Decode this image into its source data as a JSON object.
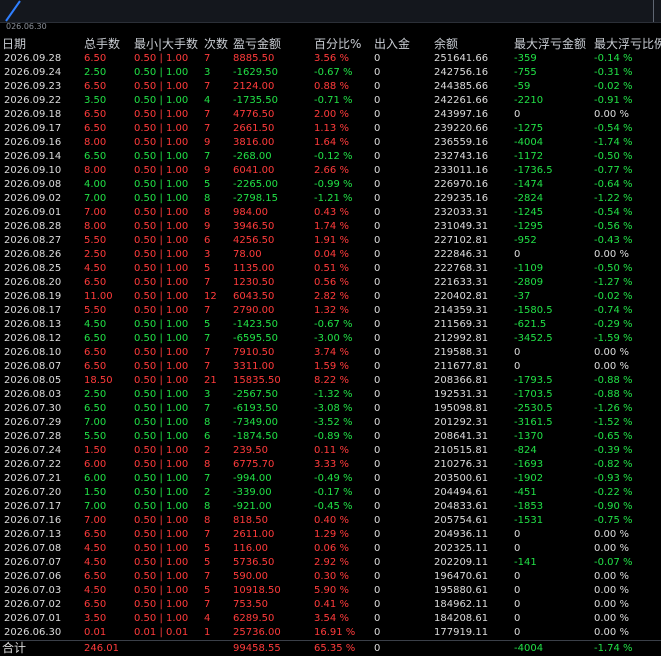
{
  "chart": {
    "date_label": "026.06.30"
  },
  "table": {
    "columns": [
      "日期",
      "总手数",
      "最小|大手数",
      "次数",
      "盈亏金额",
      "百分比%",
      "出入金",
      "余额",
      "最大浮亏金额",
      "最大浮亏比例"
    ],
    "rows": [
      {
        "date": "2026.09.28",
        "lots": "6.50",
        "minmax": "0.50 | 1.00",
        "count": "7",
        "pnl": "8885.50",
        "pct": "3.56 %",
        "io": "0",
        "balance": "251641.66",
        "maxdd": "-359",
        "maxddpct": "-0.14 %",
        "tone": "win"
      },
      {
        "date": "2026.09.24",
        "lots": "2.50",
        "minmax": "0.50 | 1.00",
        "count": "3",
        "pnl": "-1629.50",
        "pct": "-0.67 %",
        "io": "0",
        "balance": "242756.16",
        "maxdd": "-755",
        "maxddpct": "-0.31 %",
        "tone": "loss"
      },
      {
        "date": "2026.09.23",
        "lots": "6.50",
        "minmax": "0.50 | 1.00",
        "count": "7",
        "pnl": "2124.00",
        "pct": "0.88 %",
        "io": "0",
        "balance": "244385.66",
        "maxdd": "-59",
        "maxddpct": "-0.02 %",
        "tone": "win"
      },
      {
        "date": "2026.09.22",
        "lots": "3.50",
        "minmax": "0.50 | 1.00",
        "count": "4",
        "pnl": "-1735.50",
        "pct": "-0.71 %",
        "io": "0",
        "balance": "242261.66",
        "maxdd": "-2210",
        "maxddpct": "-0.91 %",
        "tone": "loss"
      },
      {
        "date": "2026.09.18",
        "lots": "6.50",
        "minmax": "0.50 | 1.00",
        "count": "7",
        "pnl": "4776.50",
        "pct": "2.00 %",
        "io": "0",
        "balance": "243997.16",
        "maxdd": "0",
        "maxddpct": "0.00 %",
        "tone": "win"
      },
      {
        "date": "2026.09.17",
        "lots": "6.50",
        "minmax": "0.50 | 1.00",
        "count": "7",
        "pnl": "2661.50",
        "pct": "1.13 %",
        "io": "0",
        "balance": "239220.66",
        "maxdd": "-1275",
        "maxddpct": "-0.54 %",
        "tone": "win"
      },
      {
        "date": "2026.09.16",
        "lots": "8.00",
        "minmax": "0.50 | 1.00",
        "count": "9",
        "pnl": "3816.00",
        "pct": "1.64 %",
        "io": "0",
        "balance": "236559.16",
        "maxdd": "-4004",
        "maxddpct": "-1.74 %",
        "tone": "win"
      },
      {
        "date": "2026.09.14",
        "lots": "6.50",
        "minmax": "0.50 | 1.00",
        "count": "7",
        "pnl": "-268.00",
        "pct": "-0.12 %",
        "io": "0",
        "balance": "232743.16",
        "maxdd": "-1172",
        "maxddpct": "-0.50 %",
        "tone": "loss"
      },
      {
        "date": "2026.09.10",
        "lots": "8.00",
        "minmax": "0.50 | 1.00",
        "count": "9",
        "pnl": "6041.00",
        "pct": "2.66 %",
        "io": "0",
        "balance": "233011.16",
        "maxdd": "-1736.5",
        "maxddpct": "-0.77 %",
        "tone": "win"
      },
      {
        "date": "2026.09.08",
        "lots": "4.00",
        "minmax": "0.50 | 1.00",
        "count": "5",
        "pnl": "-2265.00",
        "pct": "-0.99 %",
        "io": "0",
        "balance": "226970.16",
        "maxdd": "-1474",
        "maxddpct": "-0.64 %",
        "tone": "loss"
      },
      {
        "date": "2026.09.02",
        "lots": "7.00",
        "minmax": "0.50 | 1.00",
        "count": "8",
        "pnl": "-2798.15",
        "pct": "-1.21 %",
        "io": "0",
        "balance": "229235.16",
        "maxdd": "-2824",
        "maxddpct": "-1.22 %",
        "tone": "loss"
      },
      {
        "date": "2026.09.01",
        "lots": "7.00",
        "minmax": "0.50 | 1.00",
        "count": "8",
        "pnl": "984.00",
        "pct": "0.43 %",
        "io": "0",
        "balance": "232033.31",
        "maxdd": "-1245",
        "maxddpct": "-0.54 %",
        "tone": "win"
      },
      {
        "date": "2026.08.28",
        "lots": "8.00",
        "minmax": "0.50 | 1.00",
        "count": "9",
        "pnl": "3946.50",
        "pct": "1.74 %",
        "io": "0",
        "balance": "231049.31",
        "maxdd": "-1295",
        "maxddpct": "-0.56 %",
        "tone": "win"
      },
      {
        "date": "2026.08.27",
        "lots": "5.50",
        "minmax": "0.50 | 1.00",
        "count": "6",
        "pnl": "4256.50",
        "pct": "1.91 %",
        "io": "0",
        "balance": "227102.81",
        "maxdd": "-952",
        "maxddpct": "-0.43 %",
        "tone": "win"
      },
      {
        "date": "2026.08.26",
        "lots": "2.50",
        "minmax": "0.50 | 1.00",
        "count": "3",
        "pnl": "78.00",
        "pct": "0.04 %",
        "io": "0",
        "balance": "222846.31",
        "maxdd": "0",
        "maxddpct": "0.00 %",
        "tone": "win"
      },
      {
        "date": "2026.08.25",
        "lots": "4.50",
        "minmax": "0.50 | 1.00",
        "count": "5",
        "pnl": "1135.00",
        "pct": "0.51 %",
        "io": "0",
        "balance": "222768.31",
        "maxdd": "-1109",
        "maxddpct": "-0.50 %",
        "tone": "win"
      },
      {
        "date": "2026.08.20",
        "lots": "6.50",
        "minmax": "0.50 | 1.00",
        "count": "7",
        "pnl": "1230.50",
        "pct": "0.56 %",
        "io": "0",
        "balance": "221633.31",
        "maxdd": "-2809",
        "maxddpct": "-1.27 %",
        "tone": "win"
      },
      {
        "date": "2026.08.19",
        "lots": "11.00",
        "minmax": "0.50 | 1.00",
        "count": "12",
        "pnl": "6043.50",
        "pct": "2.82 %",
        "io": "0",
        "balance": "220402.81",
        "maxdd": "-37",
        "maxddpct": "-0.02 %",
        "tone": "win"
      },
      {
        "date": "2026.08.17",
        "lots": "5.50",
        "minmax": "0.50 | 1.00",
        "count": "7",
        "pnl": "2790.00",
        "pct": "1.32 %",
        "io": "0",
        "balance": "214359.31",
        "maxdd": "-1580.5",
        "maxddpct": "-0.74 %",
        "tone": "win"
      },
      {
        "date": "2026.08.13",
        "lots": "4.50",
        "minmax": "0.50 | 1.00",
        "count": "5",
        "pnl": "-1423.50",
        "pct": "-0.67 %",
        "io": "0",
        "balance": "211569.31",
        "maxdd": "-621.5",
        "maxddpct": "-0.29 %",
        "tone": "loss"
      },
      {
        "date": "2026.08.12",
        "lots": "6.50",
        "minmax": "0.50 | 1.00",
        "count": "7",
        "pnl": "-6595.50",
        "pct": "-3.00 %",
        "io": "0",
        "balance": "212992.81",
        "maxdd": "-3452.5",
        "maxddpct": "-1.59 %",
        "tone": "loss"
      },
      {
        "date": "2026.08.10",
        "lots": "6.50",
        "minmax": "0.50 | 1.00",
        "count": "7",
        "pnl": "7910.50",
        "pct": "3.74 %",
        "io": "0",
        "balance": "219588.31",
        "maxdd": "0",
        "maxddpct": "0.00 %",
        "tone": "win"
      },
      {
        "date": "2026.08.07",
        "lots": "6.50",
        "minmax": "0.50 | 1.00",
        "count": "7",
        "pnl": "3311.00",
        "pct": "1.59 %",
        "io": "0",
        "balance": "211677.81",
        "maxdd": "0",
        "maxddpct": "0.00 %",
        "tone": "win"
      },
      {
        "date": "2026.08.05",
        "lots": "18.50",
        "minmax": "0.50 | 1.00",
        "count": "21",
        "pnl": "15835.50",
        "pct": "8.22 %",
        "io": "0",
        "balance": "208366.81",
        "maxdd": "-1793.5",
        "maxddpct": "-0.88 %",
        "tone": "win"
      },
      {
        "date": "2026.08.03",
        "lots": "2.50",
        "minmax": "0.50 | 1.00",
        "count": "3",
        "pnl": "-2567.50",
        "pct": "-1.32 %",
        "io": "0",
        "balance": "192531.31",
        "maxdd": "-1703.5",
        "maxddpct": "-0.88 %",
        "tone": "loss"
      },
      {
        "date": "2026.07.30",
        "lots": "6.50",
        "minmax": "0.50 | 1.00",
        "count": "7",
        "pnl": "-6193.50",
        "pct": "-3.08 %",
        "io": "0",
        "balance": "195098.81",
        "maxdd": "-2530.5",
        "maxddpct": "-1.26 %",
        "tone": "loss"
      },
      {
        "date": "2026.07.29",
        "lots": "7.00",
        "minmax": "0.50 | 1.00",
        "count": "8",
        "pnl": "-7349.00",
        "pct": "-3.52 %",
        "io": "0",
        "balance": "201292.31",
        "maxdd": "-3161.5",
        "maxddpct": "-1.52 %",
        "tone": "loss"
      },
      {
        "date": "2026.07.28",
        "lots": "5.50",
        "minmax": "0.50 | 1.00",
        "count": "6",
        "pnl": "-1874.50",
        "pct": "-0.89 %",
        "io": "0",
        "balance": "208641.31",
        "maxdd": "-1370",
        "maxddpct": "-0.65 %",
        "tone": "loss"
      },
      {
        "date": "2026.07.24",
        "lots": "1.50",
        "minmax": "0.50 | 1.00",
        "count": "2",
        "pnl": "239.50",
        "pct": "0.11 %",
        "io": "0",
        "balance": "210515.81",
        "maxdd": "-824",
        "maxddpct": "-0.39 %",
        "tone": "win"
      },
      {
        "date": "2026.07.22",
        "lots": "6.00",
        "minmax": "0.50 | 1.00",
        "count": "8",
        "pnl": "6775.70",
        "pct": "3.33 %",
        "io": "0",
        "balance": "210276.31",
        "maxdd": "-1693",
        "maxddpct": "-0.82 %",
        "tone": "win"
      },
      {
        "date": "2026.07.21",
        "lots": "6.00",
        "minmax": "0.50 | 1.00",
        "count": "7",
        "pnl": "-994.00",
        "pct": "-0.49 %",
        "io": "0",
        "balance": "203500.61",
        "maxdd": "-1902",
        "maxddpct": "-0.93 %",
        "tone": "loss"
      },
      {
        "date": "2026.07.20",
        "lots": "1.50",
        "minmax": "0.50 | 1.00",
        "count": "2",
        "pnl": "-339.00",
        "pct": "-0.17 %",
        "io": "0",
        "balance": "204494.61",
        "maxdd": "-451",
        "maxddpct": "-0.22 %",
        "tone": "loss"
      },
      {
        "date": "2026.07.17",
        "lots": "7.00",
        "minmax": "0.50 | 1.00",
        "count": "8",
        "pnl": "-921.00",
        "pct": "-0.45 %",
        "io": "0",
        "balance": "204833.61",
        "maxdd": "-1853",
        "maxddpct": "-0.90 %",
        "tone": "loss"
      },
      {
        "date": "2026.07.16",
        "lots": "7.00",
        "minmax": "0.50 | 1.00",
        "count": "8",
        "pnl": "818.50",
        "pct": "0.40 %",
        "io": "0",
        "balance": "205754.61",
        "maxdd": "-1531",
        "maxddpct": "-0.75 %",
        "tone": "win"
      },
      {
        "date": "2026.07.13",
        "lots": "6.50",
        "minmax": "0.50 | 1.00",
        "count": "7",
        "pnl": "2611.00",
        "pct": "1.29 %",
        "io": "0",
        "balance": "204936.11",
        "maxdd": "0",
        "maxddpct": "0.00 %",
        "tone": "win"
      },
      {
        "date": "2026.07.08",
        "lots": "4.50",
        "minmax": "0.50 | 1.00",
        "count": "5",
        "pnl": "116.00",
        "pct": "0.06 %",
        "io": "0",
        "balance": "202325.11",
        "maxdd": "0",
        "maxddpct": "0.00 %",
        "tone": "win"
      },
      {
        "date": "2026.07.07",
        "lots": "4.50",
        "minmax": "0.50 | 1.00",
        "count": "5",
        "pnl": "5736.50",
        "pct": "2.92 %",
        "io": "0",
        "balance": "202209.11",
        "maxdd": "-141",
        "maxddpct": "-0.07 %",
        "tone": "win"
      },
      {
        "date": "2026.07.06",
        "lots": "6.50",
        "minmax": "0.50 | 1.00",
        "count": "7",
        "pnl": "590.00",
        "pct": "0.30 %",
        "io": "0",
        "balance": "196470.61",
        "maxdd": "0",
        "maxddpct": "0.00 %",
        "tone": "win"
      },
      {
        "date": "2026.07.03",
        "lots": "4.50",
        "minmax": "0.50 | 1.00",
        "count": "5",
        "pnl": "10918.50",
        "pct": "5.90 %",
        "io": "0",
        "balance": "195880.61",
        "maxdd": "0",
        "maxddpct": "0.00 %",
        "tone": "win"
      },
      {
        "date": "2026.07.02",
        "lots": "6.50",
        "minmax": "0.50 | 1.00",
        "count": "7",
        "pnl": "753.50",
        "pct": "0.41 %",
        "io": "0",
        "balance": "184962.11",
        "maxdd": "0",
        "maxddpct": "0.00 %",
        "tone": "win"
      },
      {
        "date": "2026.07.01",
        "lots": "3.50",
        "minmax": "0.50 | 1.00",
        "count": "4",
        "pnl": "6289.50",
        "pct": "3.54 %",
        "io": "0",
        "balance": "184208.61",
        "maxdd": "0",
        "maxddpct": "0.00 %",
        "tone": "win"
      },
      {
        "date": "2026.06.30",
        "lots": "0.01",
        "minmax": "0.01 | 0.01",
        "count": "1",
        "pnl": "25736.00",
        "pct": "16.91 %",
        "io": "0",
        "balance": "177919.11",
        "maxdd": "0",
        "maxddpct": "0.00 %",
        "tone": "win"
      }
    ],
    "total": {
      "label": "合计",
      "lots": "246.01",
      "pnl": "99458.55",
      "pct": "65.35 %",
      "io": "0",
      "maxdd": "-4004",
      "maxddpct": "-1.74 %"
    }
  },
  "colors": {
    "win": "#ff3b3b",
    "loss": "#21e046",
    "neutral": "#dcdcdc",
    "background": "#000000"
  }
}
